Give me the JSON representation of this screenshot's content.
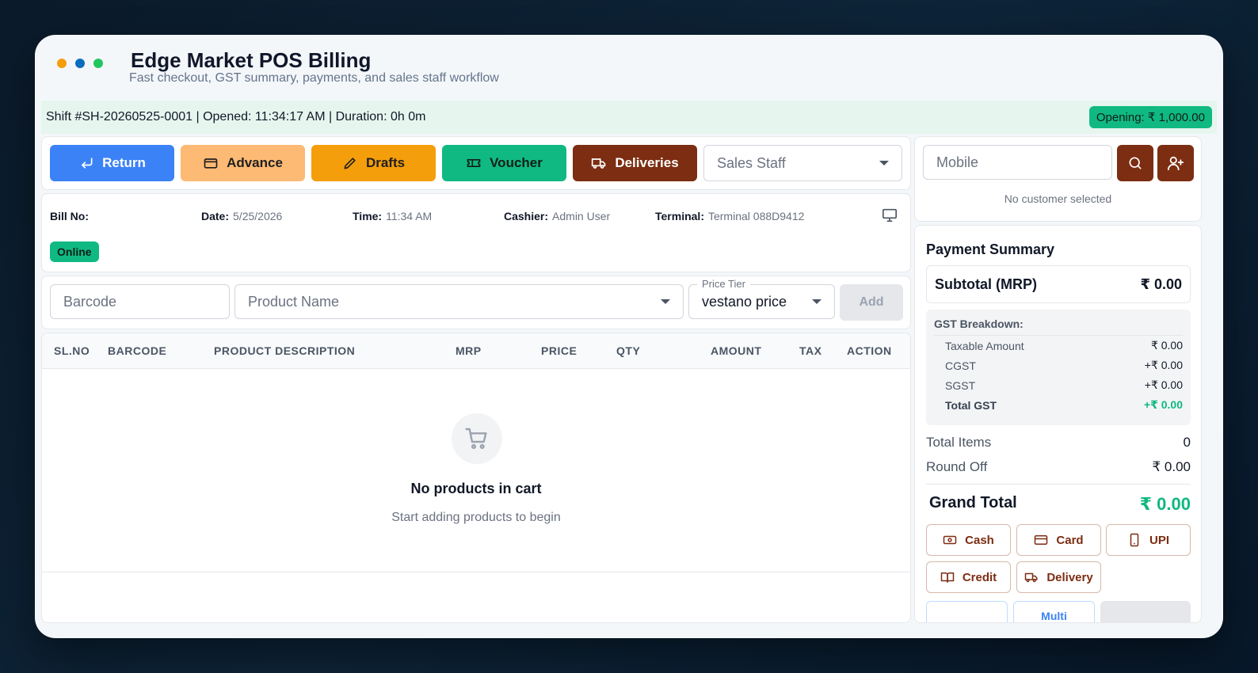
{
  "app": {
    "title": "Edge Market POS Billing",
    "subtitle": "Fast checkout, GST summary, payments, and sales staff workflow",
    "dots": [
      "#f59e0b",
      "#0a6dbd",
      "#22c55e"
    ]
  },
  "shift": {
    "info": "Shift #SH-20260525-0001 | Opened: 11:34:17 AM | Duration: 0h 0m",
    "opening": "Opening: ₹ 1,000.00"
  },
  "actions": {
    "return": "Return",
    "advance": "Advance",
    "drafts": "Drafts",
    "voucher": "Voucher",
    "deliveries": "Deliveries",
    "sales_staff_placeholder": "Sales Staff"
  },
  "bill": {
    "bill_no_label": "Bill No:",
    "bill_no": "",
    "date_label": "Date:",
    "date": "5/25/2026",
    "time_label": "Time:",
    "time": "11:34 AM",
    "cashier_label": "Cashier:",
    "cashier": "Admin User",
    "terminal_label": "Terminal:",
    "terminal": "Terminal 088D9412",
    "status": "Online"
  },
  "add_product": {
    "barcode_placeholder": "Barcode",
    "product_placeholder": "Product Name",
    "price_tier_label": "Price Tier",
    "price_tier_value": "vestano price",
    "add_label": "Add"
  },
  "cart": {
    "columns": [
      "SL.NO",
      "BARCODE",
      "PRODUCT DESCRIPTION",
      "MRP",
      "PRICE",
      "QTY",
      "AMOUNT",
      "TAX",
      "ACTION"
    ],
    "empty_title": "No products in cart",
    "empty_subtitle": "Start adding products to begin"
  },
  "customer": {
    "mobile_placeholder": "Mobile",
    "status": "No customer selected"
  },
  "payment": {
    "title": "Payment Summary",
    "subtotal_label": "Subtotal (MRP)",
    "subtotal_value": "₹ 0.00",
    "gst_title": "GST Breakdown:",
    "gst_rows": [
      {
        "label": "Taxable Amount",
        "value": "₹ 0.00"
      },
      {
        "label": "CGST",
        "value": "+₹ 0.00"
      },
      {
        "label": "SGST",
        "value": "+₹ 0.00"
      },
      {
        "label": "Total GST",
        "value": "+₹ 0.00"
      }
    ],
    "total_items_label": "Total Items",
    "total_items_value": "0",
    "round_off_label": "Round Off",
    "round_off_value": "₹ 0.00",
    "grand_total_label": "Grand Total",
    "grand_total_value": "₹ 0.00",
    "methods": {
      "cash": "Cash",
      "card": "Card",
      "upi": "UPI",
      "credit": "Credit",
      "delivery": "Delivery",
      "multi": "Multi"
    }
  }
}
